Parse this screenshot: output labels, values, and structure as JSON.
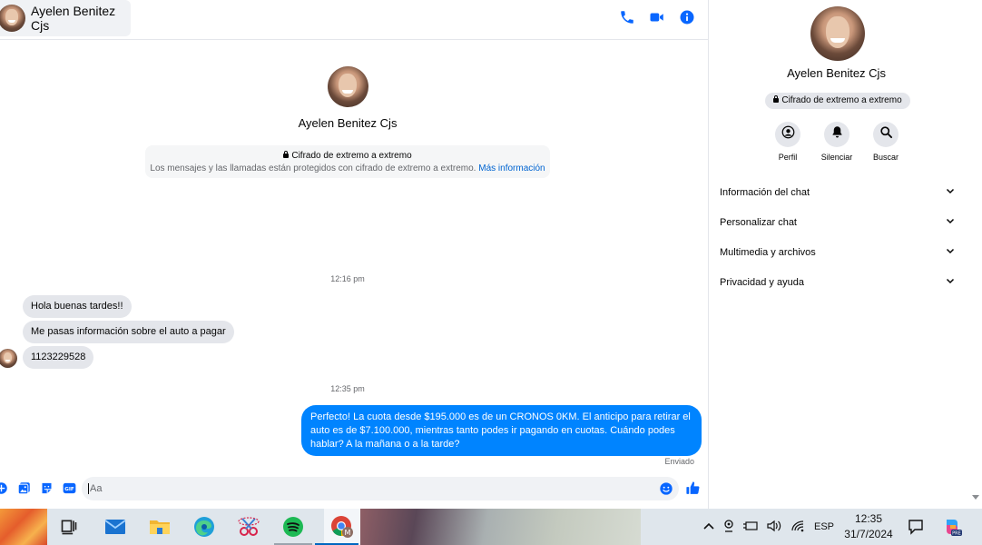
{
  "header": {
    "contact_name": "Ayelen Benitez Cjs",
    "icons": [
      "phone-icon",
      "video-icon",
      "info-icon"
    ]
  },
  "profile": {
    "name": "Ayelen Benitez Cjs"
  },
  "encryption": {
    "title": "Cifrado de extremo a extremo",
    "description": "Los mensajes y las llamadas están protegidos con cifrado de extremo a extremo.",
    "link": "Más información"
  },
  "messages": {
    "time1": "12:16 pm",
    "incoming": [
      "Hola buenas tardes!!",
      "Me pasas información sobre el auto a pagar",
      "1123229528"
    ],
    "time2": "12:35 pm",
    "outgoing": "Perfecto! La cuota desde $195.000 es de un CRONOS 0KM. El anticipo para retirar el auto es de $7.100.000, mientras tanto podes ir pagando en cuotas. Cuándo podes hablar? A la mañana o a la tarde?",
    "status": "Enviado"
  },
  "composer": {
    "placeholder": "Aa",
    "gif_label": "GIF"
  },
  "details": {
    "name": "Ayelen Benitez Cjs",
    "badge": "Cifrado de extremo a extremo",
    "actions": [
      "Perfil",
      "Silenciar",
      "Buscar"
    ],
    "sections": [
      "Información del chat",
      "Personalizar chat",
      "Multimedia y archivos",
      "Privacidad y ayuda"
    ]
  },
  "taskbar": {
    "language": "ESP",
    "time": "12:35",
    "date": "31/7/2024",
    "copilot_badge": "PRE",
    "chrome_badge": "M"
  },
  "colors": {
    "accent": "#0084ff",
    "header_icons": "#0866ff",
    "link": "#0064d1"
  }
}
